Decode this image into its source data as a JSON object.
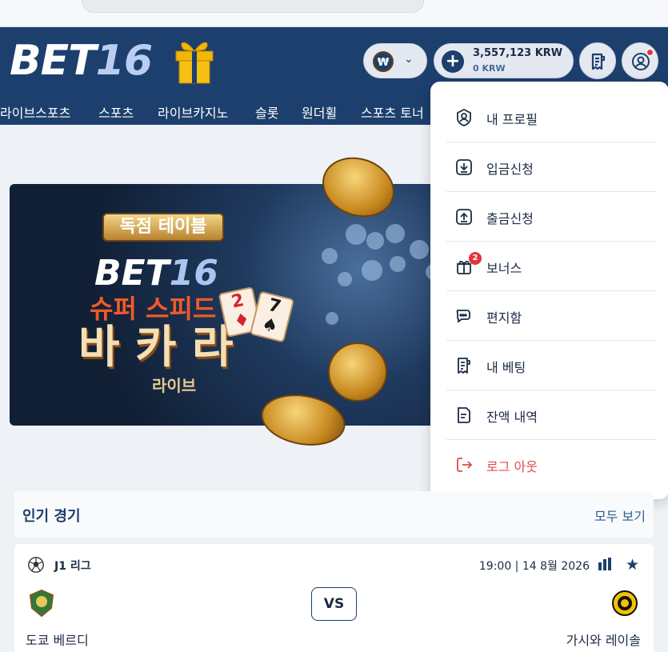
{
  "header": {
    "logo_text": "BET",
    "logo_num": "16",
    "currency_symbol": "₩",
    "balance": "3,557,123 KRW",
    "bonus_balance": "0 KRW"
  },
  "nav": {
    "items": [
      "라이브스포츠",
      "스포츠",
      "라이브카지노",
      "슬롯",
      "원더휠",
      "스포츠 토너"
    ]
  },
  "banner": {
    "badge": "독점 테이블",
    "logo_text": "BET",
    "logo_num": "16",
    "line1": "슈퍼 스피드",
    "line2": "바 카 라",
    "live": "라이브",
    "card1": "2",
    "card2": "7"
  },
  "menu": {
    "items": [
      {
        "label": "내 프로필",
        "icon": "profile-icon"
      },
      {
        "label": "입금신청",
        "icon": "deposit-icon"
      },
      {
        "label": "출금신청",
        "icon": "withdraw-icon"
      },
      {
        "label": "보너스",
        "icon": "gift-icon",
        "badge": "2"
      },
      {
        "label": "편지함",
        "icon": "messages-icon"
      },
      {
        "label": "내 베팅",
        "icon": "receipt-icon"
      },
      {
        "label": "잔액 내역",
        "icon": "document-icon"
      },
      {
        "label": "로그 아웃",
        "icon": "logout-icon"
      }
    ]
  },
  "popular": {
    "title": "인기 경기",
    "see_all": "모두 보기"
  },
  "match": {
    "league": "J1 리그",
    "time": "19:00 | 14 8월 2026",
    "vs": "VS",
    "home": "도쿄 베르디",
    "away": "가시와 레이솔"
  },
  "colors": {
    "brand": "#1c3f6e",
    "danger": "#e04a4a"
  }
}
